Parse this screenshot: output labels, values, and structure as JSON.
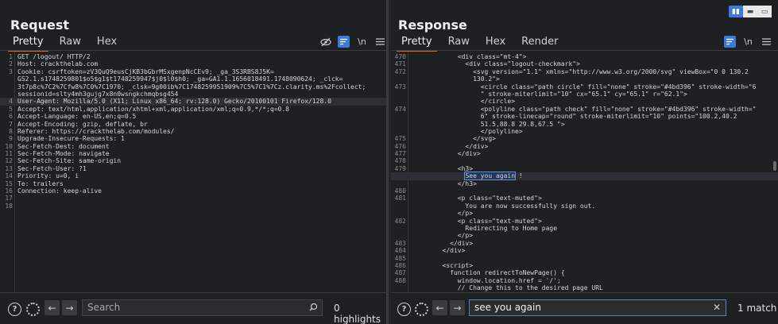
{
  "request": {
    "title": "Request",
    "tabs": [
      "Pretty",
      "Raw",
      "Hex"
    ],
    "active_tab": "Pretty",
    "lines": [
      {
        "n": "1",
        "text": "GET /logout/ HTTP/2"
      },
      {
        "n": "2",
        "text": "Host: crackthelab.com"
      },
      {
        "n": "3",
        "text": "Cookie: csrftoken=zV3QuQ9eusCjKB3bGbrMSxgenpNcCEv9; _ga_3S3RBS8J5K="
      },
      {
        "n": "",
        "text": "GS2.1.s1748259801$o5$g1$t1748259947$j0$l0$h0; _ga=GA1.1.1656018491.1748090624; _clck="
      },
      {
        "n": "",
        "text": "3t7p8c%7C2%7Cfw8%7C0%7C1970; _clsk=9g00ib%7C1748259951909%7C5%7C1%7Cz.clarity.ms%2Fcollect;"
      },
      {
        "n": "",
        "text": "sessionid=slty4mh3gujg7x8n0wsngkchmqbsg454"
      },
      {
        "n": "4",
        "text": "User-Agent: Mozilla/5.0 (X11; Linux x86_64; rv:128.0) Gecko/20100101 Firefox/128.0",
        "hl": true
      },
      {
        "n": "5",
        "text": "Accept: text/html,application/xhtml+xml,application/xml;q=0.9,*/*;q=0.8"
      },
      {
        "n": "6",
        "text": "Accept-Language: en-US,en;q=0.5"
      },
      {
        "n": "7",
        "text": "Accept-Encoding: gzip, deflate, br"
      },
      {
        "n": "8",
        "text": "Referer: https://crackthelab.com/modules/"
      },
      {
        "n": "9",
        "text": "Upgrade-Insecure-Requests: 1"
      },
      {
        "n": "10",
        "text": "Sec-Fetch-Dest: document"
      },
      {
        "n": "11",
        "text": "Sec-Fetch-Mode: navigate"
      },
      {
        "n": "12",
        "text": "Sec-Fetch-Site: same-origin"
      },
      {
        "n": "13",
        "text": "Sec-Fetch-User: ?1"
      },
      {
        "n": "14",
        "text": "Priority: u=0, i"
      },
      {
        "n": "15",
        "text": "Te: trailers"
      },
      {
        "n": "16",
        "text": "Connection: keep-alive"
      },
      {
        "n": "17",
        "text": ""
      },
      {
        "n": "18",
        "text": ""
      }
    ],
    "search": {
      "placeholder": "Search",
      "value": "",
      "count": "0 highlights"
    },
    "icons": {
      "hide": "eye-off-icon",
      "wrap": "wrap-lines-icon",
      "newline": "\\n",
      "menu": "menu-icon"
    }
  },
  "response": {
    "title": "Response",
    "tabs": [
      "Pretty",
      "Raw",
      "Hex",
      "Render"
    ],
    "active_tab": "Pretty",
    "lines": [
      {
        "n": "470",
        "text": "            <div class=\"mt-4\">"
      },
      {
        "n": "471",
        "text": "              <div class=\"logout-checkmark\">"
      },
      {
        "n": "472",
        "text": "                <svg version=\"1.1\" xmlns=\"http://www.w3.org/2000/svg\" viewBox=\"0 0 130.2"
      },
      {
        "n": "",
        "text": "                130.2\">"
      },
      {
        "n": "473",
        "text": "                  <circle class=\"path circle\" fill=\"none\" stroke=\"#4bd396\" stroke-width=\"6"
      },
      {
        "n": "",
        "text": "                  \" stroke-miterlimit=\"10\" cx=\"65.1\" cy=\"65.1\" r=\"62.1\">"
      },
      {
        "n": "",
        "text": "                  </circle>"
      },
      {
        "n": "474",
        "text": "                  <polyline class=\"path check\" fill=\"none\" stroke=\"#4bd396\" stroke-width=\""
      },
      {
        "n": "",
        "text": "                  6\" stroke-linecap=\"round\" stroke-miterlimit=\"10\" points=\"100.2,40.2"
      },
      {
        "n": "",
        "text": "                  51.5,88.8 29.8,67.5 \">"
      },
      {
        "n": "",
        "text": "                  </polyline>"
      },
      {
        "n": "475",
        "text": "                </svg>"
      },
      {
        "n": "476",
        "text": "              </div>"
      },
      {
        "n": "477",
        "text": "            </div>"
      },
      {
        "n": "478",
        "text": ""
      },
      {
        "n": "479",
        "text": "            <h3>"
      },
      {
        "n": "",
        "text": "              See you again !",
        "hl": true,
        "sel": "See you again"
      },
      {
        "n": "",
        "text": "            </h3>"
      },
      {
        "n": "480",
        "text": ""
      },
      {
        "n": "481",
        "text": "            <p class=\"text-muted\">"
      },
      {
        "n": "",
        "text": "              You are now successfully sign out."
      },
      {
        "n": "",
        "text": "            </p>"
      },
      {
        "n": "482",
        "text": "            <p class=\"text-muted\">"
      },
      {
        "n": "",
        "text": "              Redirecting to Home page"
      },
      {
        "n": "",
        "text": "            </p>"
      },
      {
        "n": "483",
        "text": "          </div>"
      },
      {
        "n": "484",
        "text": "        </div>"
      },
      {
        "n": "485",
        "text": ""
      },
      {
        "n": "486",
        "text": "        <script>"
      },
      {
        "n": "487",
        "text": "          function redirectToNewPage() {"
      },
      {
        "n": "488",
        "text": "            window.location.href = '/';"
      },
      {
        "n": "",
        "text": "            // Change this to the desired page URL"
      }
    ],
    "search": {
      "placeholder": "Search",
      "value": "see you again",
      "count": "1 match"
    },
    "icons": {
      "wrap": "wrap-lines-icon",
      "newline": "\\n",
      "menu": "menu-icon"
    }
  },
  "layout_buttons": [
    "split-horizontal-icon",
    "split-vertical-icon",
    "single-pane-icon"
  ]
}
